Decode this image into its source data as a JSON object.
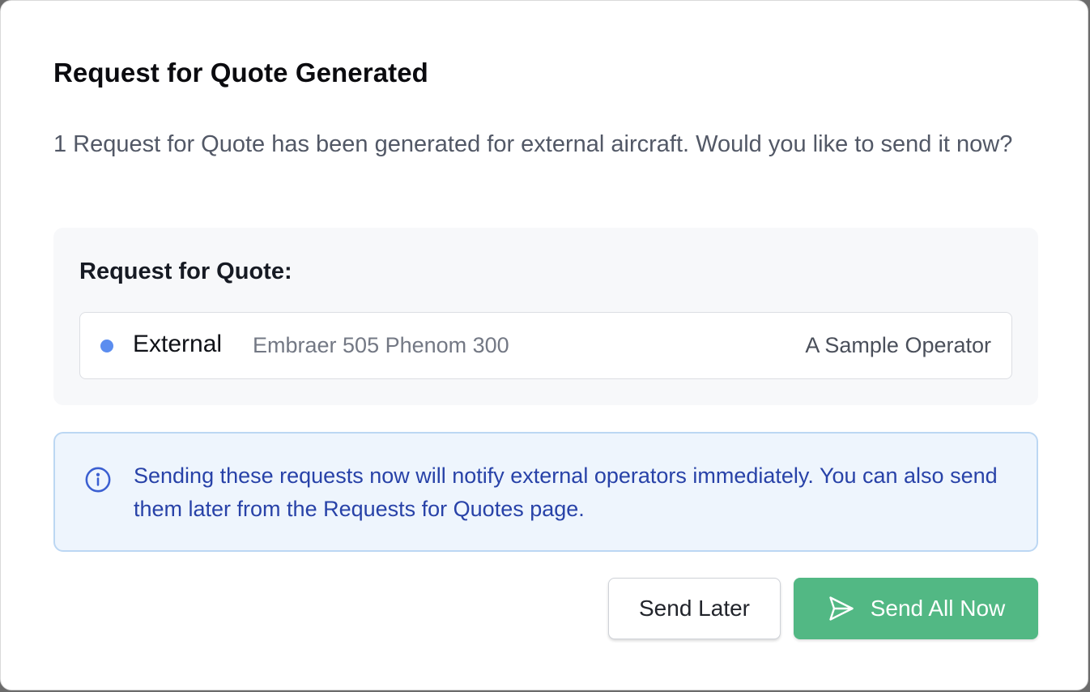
{
  "dialog": {
    "title": "Request for Quote Generated",
    "description": "1 Request for Quote has been generated for external aircraft. Would you like to send it now?"
  },
  "rfq_panel": {
    "heading": "Request for Quote:",
    "items": [
      {
        "type": "External",
        "aircraft": "Embraer 505 Phenom 300",
        "operator": "A Sample Operator",
        "dot_color": "#5b8def"
      }
    ]
  },
  "info": {
    "icon": "info-icon",
    "text": "Sending these requests now will notify external operators immediately. You can also send them later from the Requests for Quotes page."
  },
  "actions": {
    "send_later_label": "Send Later",
    "send_all_now_label": "Send All Now",
    "send_icon": "send-icon",
    "primary_color": "#52b884"
  }
}
